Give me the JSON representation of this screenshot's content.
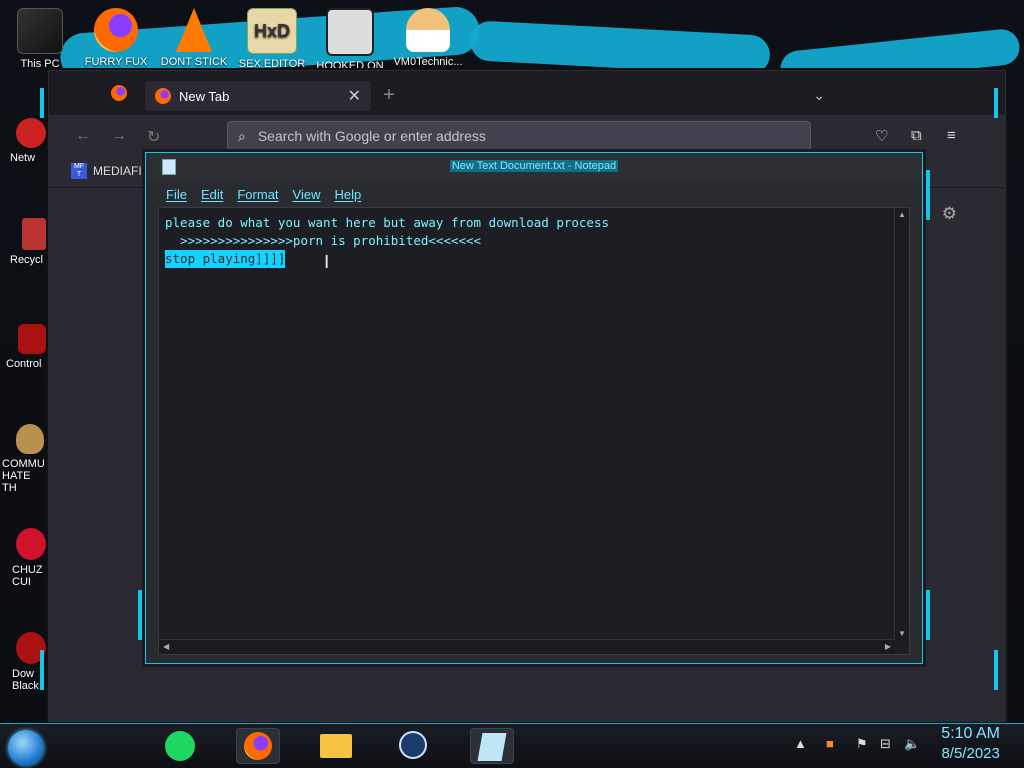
{
  "desktop_icons": [
    {
      "label": "This PC",
      "icon": "computer-icon"
    },
    {
      "label": "FURRY FUX",
      "icon": "firefox-icon"
    },
    {
      "label": "DONT STICK",
      "icon": "vlc-icon"
    },
    {
      "label": "SEX EDITOR",
      "icon": "hxd-icon"
    },
    {
      "label": "HOOKED ON",
      "icon": "maze-icon"
    },
    {
      "label": "VM0Technic...",
      "icon": "doctor-icon"
    }
  ],
  "left_icons": [
    {
      "label": "Netw",
      "icon": "network-icon"
    },
    {
      "label": "Recycl",
      "icon": "recycle-bin-icon"
    },
    {
      "label": "Control",
      "icon": "control-panel-icon"
    },
    {
      "label": "COMMU HATE TH",
      "icon": "money-bag-icon"
    },
    {
      "label": "CHUZ CUI",
      "icon": "red-creature-icon"
    },
    {
      "label": "Dow Black",
      "icon": "download-icon"
    }
  ],
  "browser": {
    "tab_title": "New Tab",
    "search_placeholder": "Search with Google or enter address",
    "bookmark_label": "MEDIAFI",
    "bookmark_icon_text": "MF T"
  },
  "notepad": {
    "title": "New Text Document.txt - Notepad",
    "menus": [
      "File",
      "Edit",
      "Format",
      "View",
      "Help"
    ],
    "lines": [
      "please do what you want here but away from download process",
      "  >>>>>>>>>>>>>>>porn is prohibited<<<<<<<",
      "stop playing]]]]"
    ]
  },
  "taskbar": {
    "apps": [
      "notes-app-icon",
      "firefox-icon",
      "file-explorer-icon",
      "steam-icon",
      "notepad-icon"
    ],
    "time": "5:10 AM",
    "date": "8/5/2023"
  }
}
